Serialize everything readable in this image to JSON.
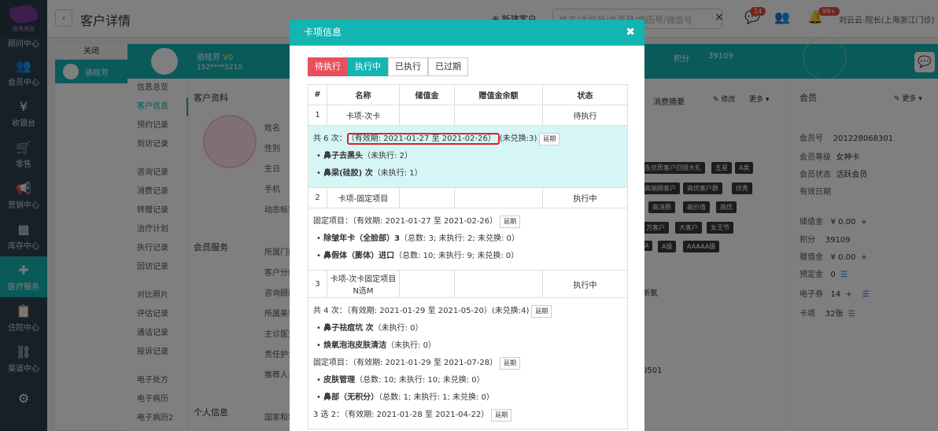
{
  "sidebar": {
    "logo_text": "恒秀美容",
    "top_partial": "顾问中心",
    "items": [
      {
        "icon": "people-icon",
        "glyph": "👥",
        "label": "会员中心"
      },
      {
        "icon": "yen-icon",
        "glyph": "¥",
        "label": "收银台"
      },
      {
        "icon": "cart-icon",
        "glyph": "🛒",
        "label": "零售"
      },
      {
        "icon": "megaphone-icon",
        "glyph": "📢",
        "label": "营销中心"
      },
      {
        "icon": "grid-icon",
        "glyph": "▦",
        "label": "库存中心"
      },
      {
        "icon": "medical-icon",
        "glyph": "✚",
        "label": "医疗服务"
      },
      {
        "icon": "clipboard-icon",
        "glyph": "📋",
        "label": "住院中心"
      },
      {
        "icon": "org-icon",
        "glyph": "⛓",
        "label": "渠道中心"
      },
      {
        "icon": "settings-icon",
        "glyph": "⚙",
        "label": ""
      }
    ]
  },
  "topbar": {
    "back": "‹",
    "title": "客户详情",
    "new_customer": "新建客户",
    "search_placeholder": "姓名/手机号/会员号/病历号/微信号",
    "clear": "×",
    "badge1": "14",
    "badge2": "99+",
    "user": "刘云云-院长(上海浙江门诊)"
  },
  "tabs": {
    "close": "关闭",
    "customer": "骆桂芳"
  },
  "band": {
    "name": "骆桂芳",
    "vip": "V0",
    "phone": "152****5210",
    "score_label": "积分",
    "score_value": "39109"
  },
  "submenu": {
    "group1": [
      "信息总览",
      "客户信息",
      "预约记录",
      "到访记录"
    ],
    "group2": [
      "咨询记录",
      "消费记录",
      "转赠记录",
      "治疗计划",
      "执行记录",
      "回访记录"
    ],
    "group3": [
      "对比照片",
      "评估记录",
      "通话记录",
      "投诉记录"
    ],
    "group4": [
      "电子处方",
      "电子病历",
      "电子病历2"
    ]
  },
  "main": {
    "section_profile": "客户资料",
    "section_service": "会员服务",
    "section_personal": "个人信息",
    "fields": [
      "姓名",
      "性别",
      "生日",
      "手机",
      "动态标签"
    ],
    "service_fields": [
      "所属门店",
      "客户分组",
      "咨询顾问",
      "所属美容师",
      "主诊医生",
      "责任护士",
      "推荐人员"
    ],
    "personal_fields": [
      "国家和地区"
    ],
    "consume_summary": "消费摘要",
    "edit": "✎ 修改",
    "more": "更多 ▾",
    "member": "会员",
    "member_more": "✎ 更多 ▾",
    "fresh": "新氧",
    "num_tail": "0501"
  },
  "tags": [
    "东优质客户回馈大礼",
    "五星",
    "A类",
    "高端顾客户",
    "高优客户群",
    "优秀",
    "高消费",
    "高价值",
    "高优",
    "万客户",
    "大客户",
    "女王节",
    "A",
    "A级",
    "AAAAA级"
  ],
  "member": {
    "no_label": "会员号",
    "no": "201228068301",
    "level_label": "会员等级",
    "level": "女神卡",
    "status_label": "会员状态",
    "status": "活跃会员",
    "valid_label": "有效日期",
    "stored_label": "储值金",
    "stored": "¥ 0.00",
    "score_label": "积分",
    "score": "39109",
    "gift_label": "赠值金",
    "gift": "¥ 0.00",
    "deposit_label": "预定金",
    "deposit": "0",
    "coupon_label": "电子券",
    "coupon": "14",
    "card_label": "卡项",
    "card": "32张"
  },
  "modal": {
    "title": "卡项信息",
    "close": "✖",
    "tabs": [
      "待执行",
      "执行中",
      "已执行",
      "已过期"
    ],
    "headers": [
      "#",
      "名称",
      "储值金",
      "赠值金余额",
      "状态"
    ],
    "rows": [
      {
        "no": "1",
        "name": "卡项-次卡",
        "status": "待执行",
        "details": [
          {
            "type": "head",
            "prefix": "共 6 次：",
            "range": "（有效期: 2021-01-27 至 2021-02-26）",
            "suffix": "(未兑换:3)",
            "ext": "延期"
          },
          {
            "type": "item",
            "name": "鼻子去黑头",
            "info": "（未执行: 2）"
          },
          {
            "type": "item",
            "name": "鼻梁(硅胶) 次",
            "info": "（未执行: 1）"
          }
        ]
      },
      {
        "no": "2",
        "name": "卡项-固定项目",
        "status": "执行中",
        "details": [
          {
            "type": "head",
            "prefix": "固定项目：",
            "range": "（有效期: 2021-01-27 至 2021-02-26）",
            "suffix": "",
            "ext": "延期"
          },
          {
            "type": "item",
            "name": "除皱年卡（全脸部）3",
            "info": "（总数: 3; 未执行: 2; 未兑换: 0）"
          },
          {
            "type": "item",
            "name": "鼻假体（膨体）进口",
            "info": "（总数: 10; 未执行: 9; 未兑换: 0）"
          }
        ]
      },
      {
        "no": "3",
        "name": "卡项-次卡固定项目N选M",
        "status": "执行中",
        "details": [
          {
            "type": "head",
            "prefix": "共 4 次：",
            "range": "（有效期: 2021-01-29 至 2021-05-20）",
            "suffix": "(未兑换:4)",
            "ext": "延期"
          },
          {
            "type": "item",
            "name": "鼻子祛痘坑 次",
            "info": "（未执行: 0）"
          },
          {
            "type": "item",
            "name": "焕氧泡泡皮肤清洁",
            "info": "（未执行: 0）"
          },
          {
            "type": "head",
            "prefix": "固定项目：",
            "range": "（有效期: 2021-01-29 至 2021-07-28）",
            "suffix": "",
            "ext": "延期"
          },
          {
            "type": "item",
            "name": "皮肤管理",
            "info": "（总数: 10; 未执行: 10; 未兑换: 0）"
          },
          {
            "type": "item",
            "name": "鼻部（无积分）",
            "info": "（总数: 1; 未执行: 1; 未兑换: 0）"
          },
          {
            "type": "head",
            "prefix": "3 选 2：",
            "range": "（有效期: 2021-01-28 至 2021-04-22）",
            "suffix": "",
            "ext": "延期"
          }
        ]
      }
    ]
  }
}
